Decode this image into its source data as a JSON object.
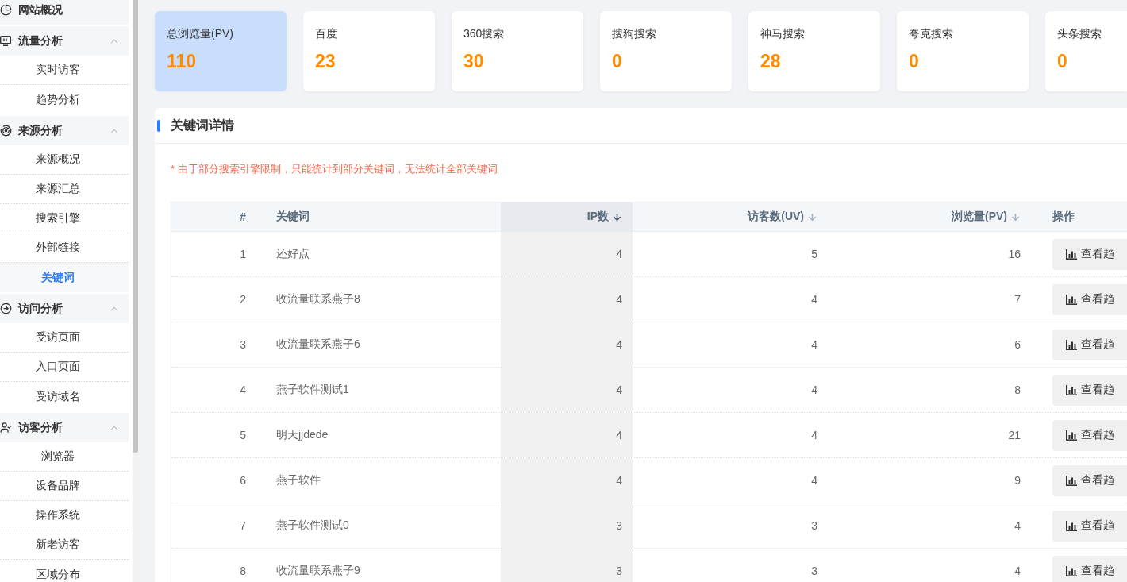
{
  "sidebar": {
    "items": [
      {
        "kind": "link",
        "label": "网站概况",
        "selected": false
      },
      {
        "kind": "group",
        "label": "流量分析",
        "expanded": true,
        "children": [
          {
            "label": "实时访客",
            "selected": false
          },
          {
            "label": "趋势分析",
            "selected": false
          }
        ]
      },
      {
        "kind": "group",
        "label": "来源分析",
        "expanded": true,
        "children": [
          {
            "label": "来源概况",
            "selected": false
          },
          {
            "label": "来源汇总",
            "selected": false
          },
          {
            "label": "搜索引擎",
            "selected": false
          },
          {
            "label": "外部链接",
            "selected": false
          },
          {
            "label": "关键词",
            "selected": true
          }
        ]
      },
      {
        "kind": "group",
        "label": "访问分析",
        "expanded": true,
        "children": [
          {
            "label": "受访页面",
            "selected": false
          },
          {
            "label": "入口页面",
            "selected": false
          },
          {
            "label": "受访域名",
            "selected": false
          }
        ]
      },
      {
        "kind": "group",
        "label": "访客分析",
        "expanded": true,
        "children": [
          {
            "label": "浏览器",
            "selected": false
          },
          {
            "label": "设备品牌",
            "selected": false
          },
          {
            "label": "操作系统",
            "selected": false
          },
          {
            "label": "新老访客",
            "selected": false
          },
          {
            "label": "区域分布",
            "selected": false
          }
        ]
      }
    ]
  },
  "stats": [
    {
      "label": "总浏览量(PV)",
      "value": "110",
      "selected": true
    },
    {
      "label": "百度",
      "value": "23",
      "selected": false
    },
    {
      "label": "360搜索",
      "value": "30",
      "selected": false
    },
    {
      "label": "搜狗搜索",
      "value": "0",
      "selected": false
    },
    {
      "label": "神马搜索",
      "value": "28",
      "selected": false
    },
    {
      "label": "夸克搜索",
      "value": "0",
      "selected": false
    },
    {
      "label": "头条搜索",
      "value": "0",
      "selected": false
    }
  ],
  "panel": {
    "title": "关键词详情",
    "notice": "* 由于部分搜索引擎限制，只能统计到部分关键词，无法统计全部关键词",
    "table": {
      "columns": [
        {
          "label": "#",
          "sortable": false,
          "sorted": false
        },
        {
          "label": "关键词",
          "sortable": false,
          "sorted": false
        },
        {
          "label": "IP数",
          "sortable": true,
          "sorted": true
        },
        {
          "label": "访客数(UV)",
          "sortable": true,
          "sorted": false
        },
        {
          "label": "浏览量(PV)",
          "sortable": true,
          "sorted": false
        },
        {
          "label": "操作",
          "sortable": false,
          "sorted": false
        }
      ],
      "rows": [
        {
          "cells": [
            "1",
            "还好点",
            "4",
            "5",
            "16"
          ],
          "action": "查看趋"
        },
        {
          "cells": [
            "2",
            "收流量联系燕子8",
            "4",
            "4",
            "7"
          ],
          "action": "查看趋"
        },
        {
          "cells": [
            "3",
            "收流量联系燕子6",
            "4",
            "4",
            "6"
          ],
          "action": "查看趋"
        },
        {
          "cells": [
            "4",
            "燕子软件测试1",
            "4",
            "4",
            "8"
          ],
          "action": "查看趋"
        },
        {
          "cells": [
            "5",
            "明天jjdede",
            "4",
            "4",
            "21"
          ],
          "action": "查看趋"
        },
        {
          "cells": [
            "6",
            "燕子软件",
            "4",
            "4",
            "9"
          ],
          "action": "查看趋"
        },
        {
          "cells": [
            "7",
            "燕子软件测试0",
            "3",
            "3",
            "4"
          ],
          "action": "查看趋"
        },
        {
          "cells": [
            "8",
            "收流量联系燕子9",
            "3",
            "3",
            "4"
          ],
          "action": "查看趋"
        }
      ]
    }
  }
}
